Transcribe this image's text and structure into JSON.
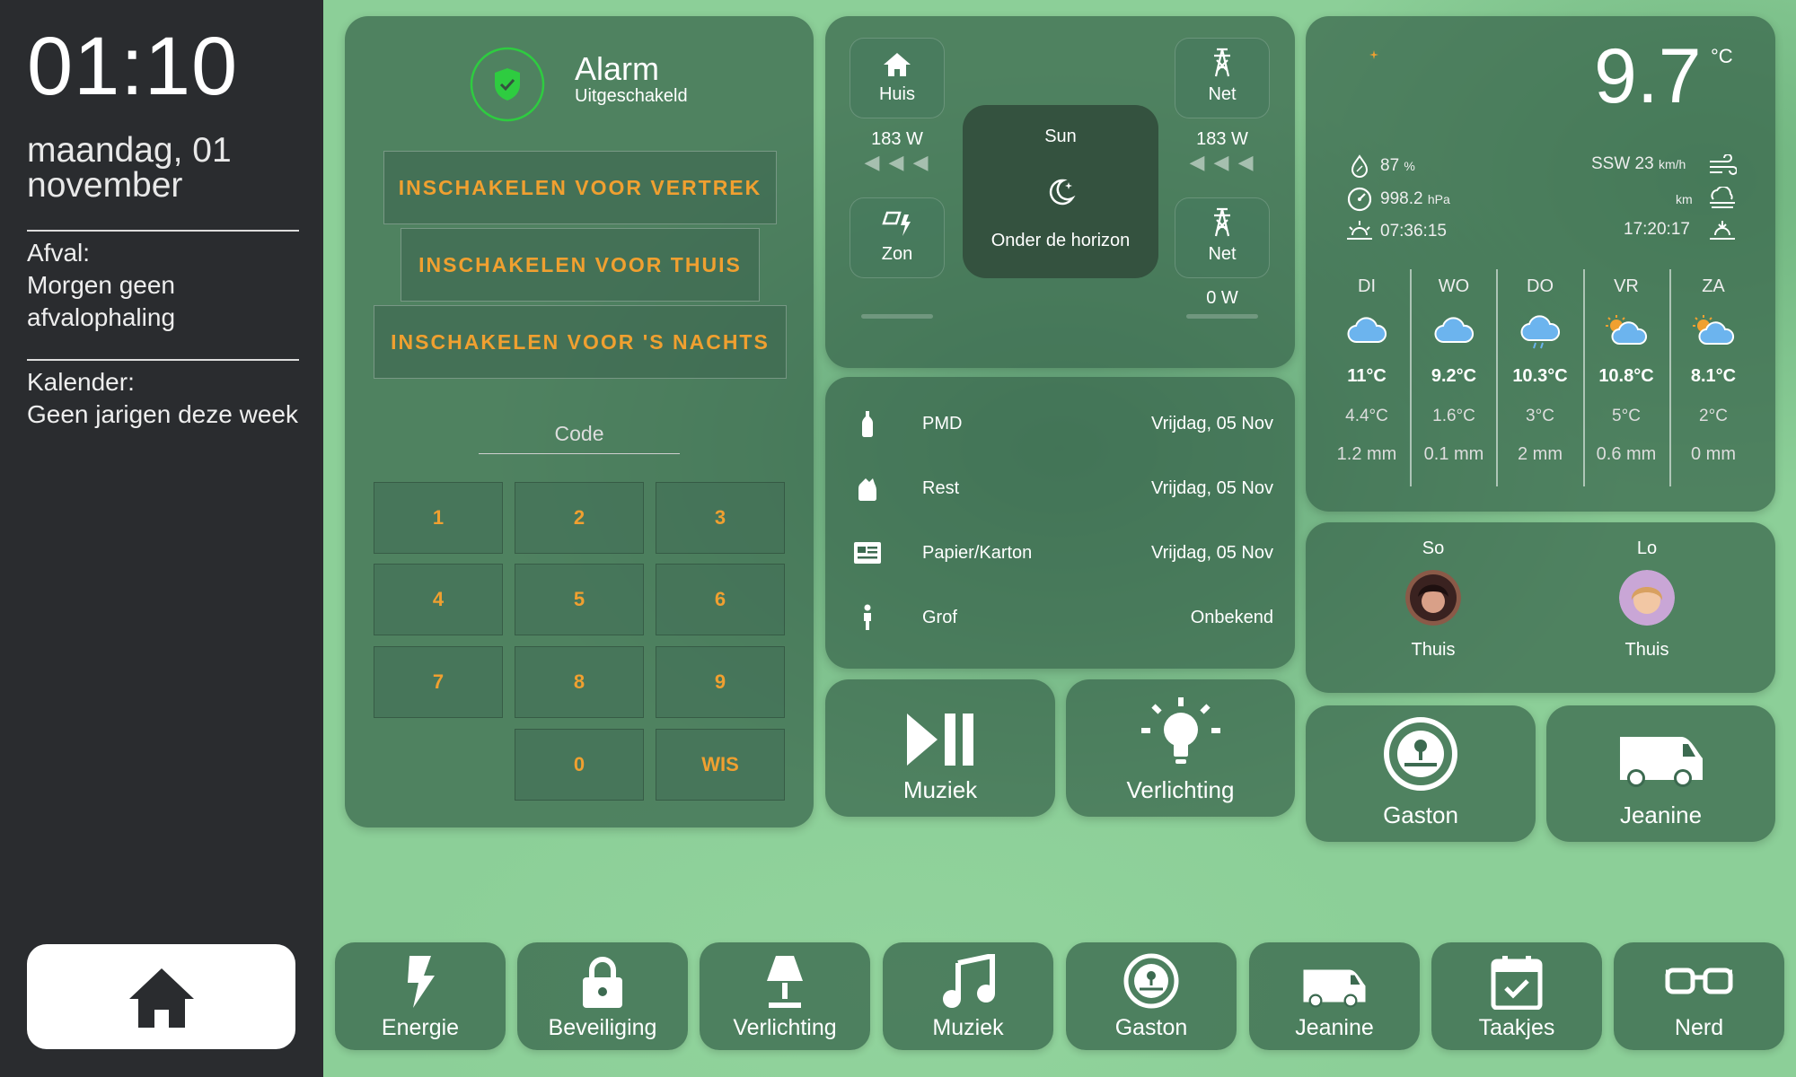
{
  "sidebar": {
    "time": "01:10",
    "date": "maandag, 01 november",
    "afval_label": "Afval:",
    "afval_value": "Morgen geen afvalophaling",
    "kalender_label": "Kalender:",
    "kalender_value": "Geen jarigen deze week"
  },
  "alarm": {
    "title": "Alarm",
    "status": "Uitgeschakeld",
    "buttons": [
      "INSCHAKELEN VOOR VERTREK",
      "INSCHAKELEN VOOR THUIS",
      "INSCHAKELEN VOOR 'S NACHTS"
    ],
    "code_label": "Code",
    "keys": [
      "1",
      "2",
      "3",
      "4",
      "5",
      "6",
      "7",
      "8",
      "9",
      "0",
      "WIS"
    ]
  },
  "energy": {
    "huis_label": "Huis",
    "huis_value": "183 W",
    "zon_label": "Zon",
    "net_top_label": "Net",
    "net_top_value": "183 W",
    "net_bottom_label": "Net",
    "net_bottom_value": "0 W",
    "sun_title": "Sun",
    "sun_state": "Onder de horizon",
    "arrows": "◀ ◀ ◀"
  },
  "waste": [
    {
      "name": "PMD",
      "date": "Vrijdag, 05 Nov",
      "icon": "bottle-icon"
    },
    {
      "name": "Rest",
      "date": "Vrijdag, 05 Nov",
      "icon": "trash-bag-icon"
    },
    {
      "name": "Papier/Karton",
      "date": "Vrijdag, 05 Nov",
      "icon": "newspaper-icon"
    },
    {
      "name": "Grof",
      "date": "Onbekend",
      "icon": "person-icon"
    }
  ],
  "tiles": {
    "muziek": "Muziek",
    "verlichting": "Verlichting",
    "gaston": "Gaston",
    "jeanine": "Jeanine"
  },
  "weather": {
    "temp": "9.7",
    "unit": "°C",
    "humidity": "87",
    "humidity_unit": "%",
    "pressure": "998.2",
    "pressure_unit": "hPa",
    "sunrise": "07:36:15",
    "wind": "SSW 23",
    "wind_unit": "km/h",
    "visibility_unit": "km",
    "sunset": "17:20:17",
    "forecast": [
      {
        "day": "DI",
        "hi": "11°C",
        "lo": "4.4°C",
        "rain": "1.2 mm",
        "icon": "cloudy-icon"
      },
      {
        "day": "WO",
        "hi": "9.2°C",
        "lo": "1.6°C",
        "rain": "0.1 mm",
        "icon": "cloudy-icon"
      },
      {
        "day": "DO",
        "hi": "10.3°C",
        "lo": "3°C",
        "rain": "2 mm",
        "icon": "rainy-icon"
      },
      {
        "day": "VR",
        "hi": "10.8°C",
        "lo": "5°C",
        "rain": "0.6 mm",
        "icon": "partly-cloudy-icon"
      },
      {
        "day": "ZA",
        "hi": "8.1°C",
        "lo": "2°C",
        "rain": "0 mm",
        "icon": "partly-cloudy-icon"
      }
    ]
  },
  "people": [
    {
      "name": "So",
      "state": "Thuis"
    },
    {
      "name": "Lo",
      "state": "Thuis"
    }
  ],
  "nav": [
    "Energie",
    "Beveiliging",
    "Verlichting",
    "Muziek",
    "Gaston",
    "Jeanine",
    "Taakjes",
    "Nerd"
  ],
  "colors": {
    "accent": "#f0a030",
    "sidebar": "#2a2c2f",
    "card": "#3c6a50",
    "alarm_ok": "#2ecc40"
  }
}
